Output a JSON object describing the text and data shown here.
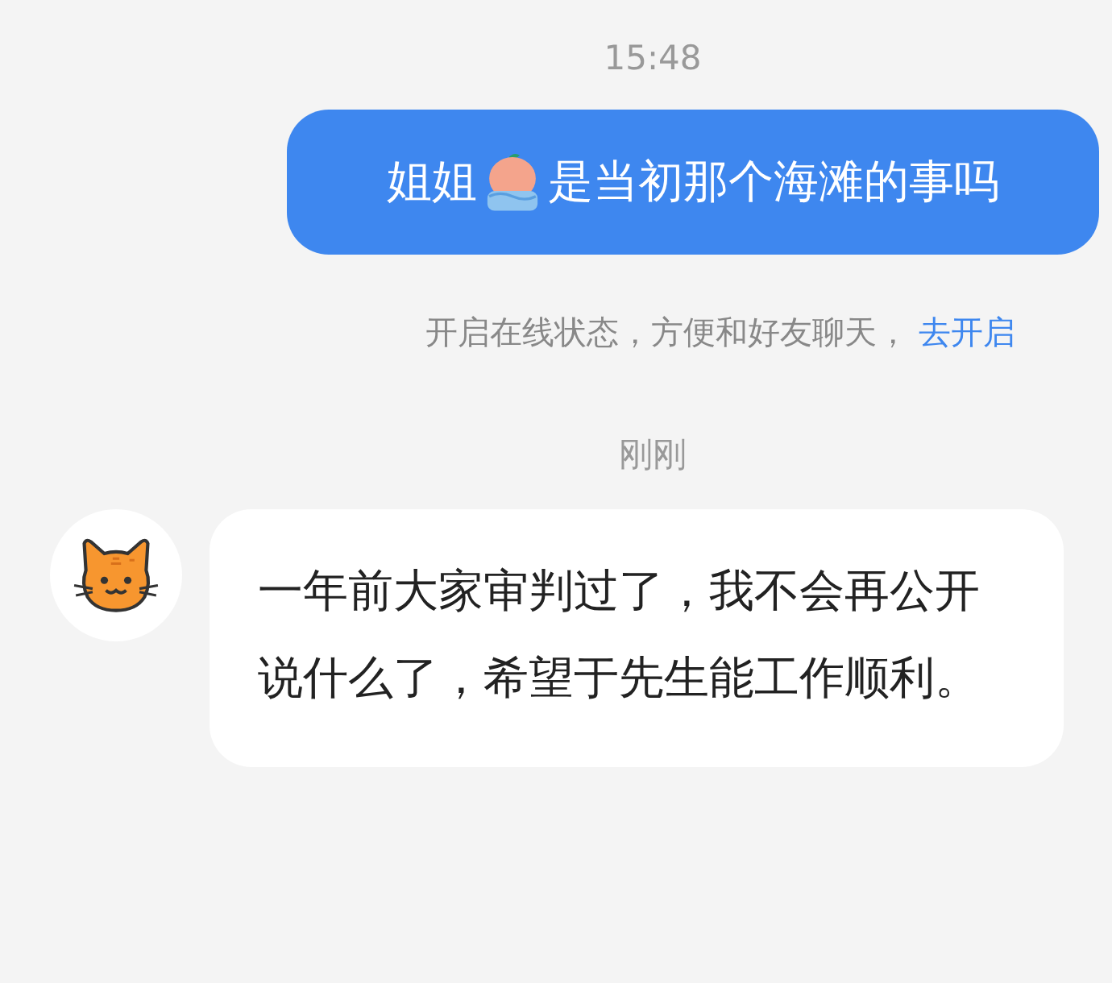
{
  "messages": [
    {
      "kind": "time",
      "text": "15:48"
    },
    {
      "kind": "outgoing",
      "parts": [
        "姐姐",
        "是当初那个海滩的事吗"
      ]
    },
    {
      "kind": "notice",
      "text": "开启在线状态，方便和好友聊天，",
      "link": "去开启"
    },
    {
      "kind": "time",
      "text": "刚刚"
    },
    {
      "kind": "incoming",
      "text": "一年前大家审判过了，我不会再公开说什么了，希望于先生能工作顺利。"
    }
  ]
}
